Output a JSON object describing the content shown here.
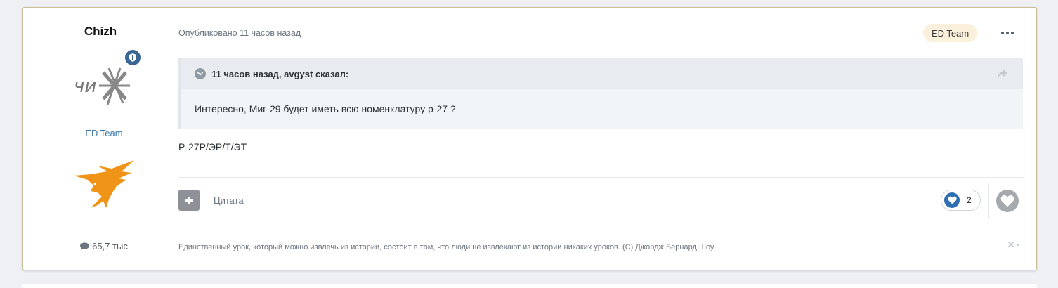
{
  "author": {
    "name": "Chizh",
    "group": "ED Team",
    "post_count": "65,7 тыс"
  },
  "post": {
    "date": "Опубликовано 11 часов назад",
    "badge": "ED Team",
    "quote_header": "11 часов назад, avgyst сказал:",
    "quote_text": "Интересно, Миг-29  будет иметь всю номенклатуру р-27 ?",
    "content": "Р-27Р/ЭР/Т/ЭТ",
    "quote_link_label": "Цитата",
    "reaction_count": "2",
    "signature": "Единственный урок, который можно извлечь из истории, состоит в том, что люди не извлекают из истории никаких уроков. (С) Джордж Бернард Шоу"
  },
  "colors": {
    "accent": "#3d6594",
    "group_link": "#3d78a8",
    "badge_bg": "#fbf0dc",
    "post_border": "#cbbd95"
  },
  "icons": [
    "shield-icon",
    "comment-icon",
    "chevron-down-icon",
    "share-icon",
    "plus-icon",
    "heart-icon",
    "close-icon",
    "more-icon"
  ]
}
